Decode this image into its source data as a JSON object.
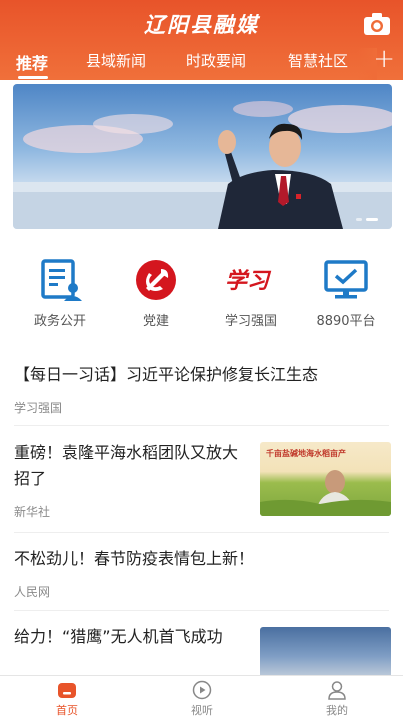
{
  "header": {
    "app_title": "辽阳县融媒",
    "tabs": [
      "推荐",
      "县域新闻",
      "时政要闻",
      "智慧社区"
    ],
    "active_tab": "推荐",
    "plus": "+"
  },
  "quick_links": [
    {
      "label": "政务公开",
      "icon": "document-icon"
    },
    {
      "label": "党建",
      "icon": "party-emblem-icon"
    },
    {
      "label": "学习强国",
      "icon": "xuexi-logo-icon"
    },
    {
      "label": "8890平台",
      "icon": "monitor-check-icon"
    }
  ],
  "news": [
    {
      "title": "【每日一习话】习近平论保护修复长江生态",
      "source": "学习强国"
    },
    {
      "title": "重磅！袁隆平海水稻团队又放大招了",
      "source": "新华社"
    },
    {
      "title": "不松劲儿！春节防疫表情包上新！",
      "source": "人民网"
    },
    {
      "title": "给力！“猎鹰”无人机首飞成功",
      "source": ""
    }
  ],
  "thumb1_caption": "千亩盐碱地海水稻亩产",
  "bottom_nav": [
    {
      "label": "首页",
      "icon": "home-icon"
    },
    {
      "label": "视听",
      "icon": "play-icon"
    },
    {
      "label": "我的",
      "icon": "user-icon"
    }
  ],
  "colors": {
    "brand": "#e8542a",
    "party_red": "#d4161e",
    "blue": "#1e7ac7"
  }
}
